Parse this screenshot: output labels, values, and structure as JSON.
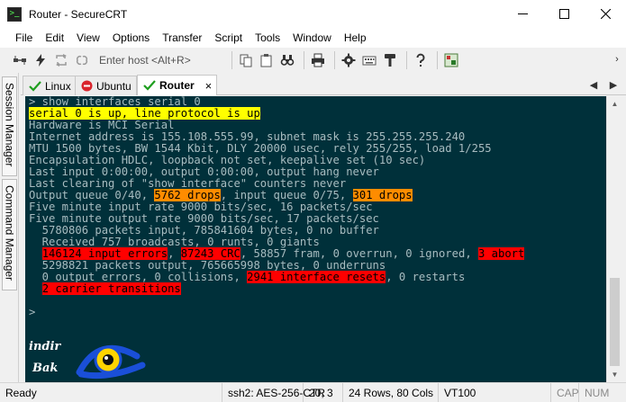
{
  "window": {
    "title": "Router - SecureCRT",
    "app_icon_glyph": ">_"
  },
  "menu": {
    "items": [
      "File",
      "Edit",
      "View",
      "Options",
      "Transfer",
      "Script",
      "Tools",
      "Window",
      "Help"
    ]
  },
  "toolbar": {
    "host_placeholder": "Enter host <Alt+R>",
    "icons_left": [
      "connect-icon",
      "quick-connect-icon",
      "reconnect-icon",
      "disconnect-icon"
    ],
    "icons_right": [
      "copy-icon",
      "paste-icon",
      "find-icon",
      "print-icon",
      "settings-icon",
      "keymap-icon",
      "sftp-icon",
      "help-icon",
      "screenshot-icon"
    ]
  },
  "side_panel": {
    "session_manager": "Session Manager",
    "command_manager": "Command Manager"
  },
  "tabs": [
    {
      "label": "Linux",
      "status": "connected",
      "status_color": "#1e9e1e"
    },
    {
      "label": "Ubuntu",
      "status": "disconnected",
      "status_color": "#d9242c"
    },
    {
      "label": "Router",
      "status": "connected",
      "status_color": "#1e9e1e",
      "active": true
    }
  ],
  "tab_close_glyph": "×",
  "terminal": {
    "background": "#00303a",
    "foreground": "#a8bcc0",
    "lines": [
      [
        {
          "t": "> show interfaces serial 0"
        }
      ],
      [
        {
          "t": "serial 0 is up, line protocol is up",
          "hl": "yellow"
        }
      ],
      [
        {
          "t": "Hardware is MCI Serial"
        }
      ],
      [
        {
          "t": "Internet address is 155.108.555.99, subnet mask is 255.255.255.240"
        }
      ],
      [
        {
          "t": "MTU 1500 bytes, BW 1544 Kbit, DLY 20000 usec, rely 255/255, load 1/255"
        }
      ],
      [
        {
          "t": "Encapsulation HDLC, loopback not set, keepalive set (10 sec)"
        }
      ],
      [
        {
          "t": "Last input 0:00:00, output 0:00:00, output hang never"
        }
      ],
      [
        {
          "t": "Last clearing of \"show interface\" counters never"
        }
      ],
      [
        {
          "t": "Output queue 0/40, "
        },
        {
          "t": "5762 drops",
          "hl": "orange"
        },
        {
          "t": ", input queue 0/75, "
        },
        {
          "t": "301 drops",
          "hl": "orange"
        }
      ],
      [
        {
          "t": "Five minute input rate 9000 bits/sec, 16 packets/sec"
        }
      ],
      [
        {
          "t": "Five minute output rate 9000 bits/sec, 17 packets/sec"
        }
      ],
      [
        {
          "t": "  5780806 packets input, 785841604 bytes, 0 no buffer"
        }
      ],
      [
        {
          "t": "  Received 757 broadcasts, 0 runts, 0 giants"
        }
      ],
      [
        {
          "t": "  "
        },
        {
          "t": "146124 input errors",
          "hl": "red"
        },
        {
          "t": ", "
        },
        {
          "t": "87243 CRC",
          "hl": "red"
        },
        {
          "t": ", 58857 fram, 0 overrun, 0 ignored, "
        },
        {
          "t": "3 abort",
          "hl": "red"
        }
      ],
      [
        {
          "t": "  5298821 packets output, 765665998 bytes, 0 underruns"
        }
      ],
      [
        {
          "t": "  0 output errors, 0 collisions, "
        },
        {
          "t": "2941 interface resets",
          "hl": "red"
        },
        {
          "t": ", 0 restarts"
        }
      ],
      [
        {
          "t": "  "
        },
        {
          "t": "2 carrier transitions",
          "hl": "red"
        }
      ],
      [
        {
          "t": ""
        }
      ],
      [
        {
          "t": ">"
        }
      ]
    ]
  },
  "watermark": {
    "word1": "indir",
    "word2": "Bak"
  },
  "status_bar": {
    "ready": "Ready",
    "cipher": "ssh2: AES-256-CTR",
    "cursor": "20,  3",
    "size": "24 Rows, 80 Cols",
    "emulation": "VT100",
    "caps": "CAP",
    "num": "NUM"
  }
}
